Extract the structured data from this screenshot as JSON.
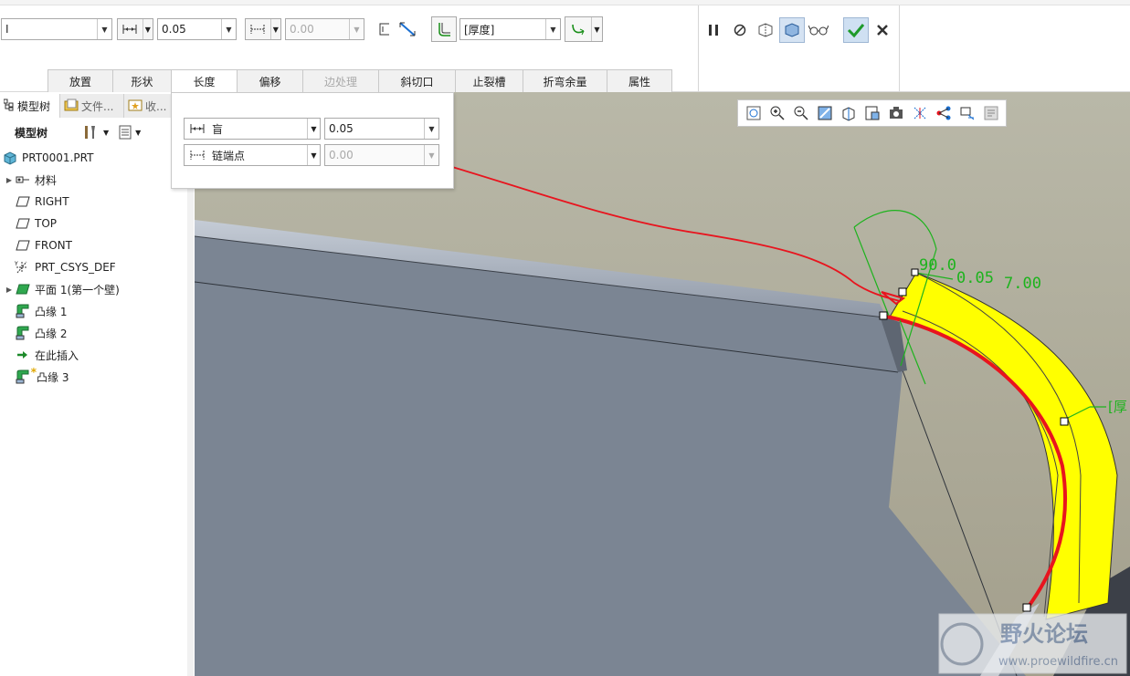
{
  "dashboard": {
    "type_combo": {
      "value": "I"
    },
    "length_value": "0.05",
    "second_length_value": "0.00",
    "thickness_combo": {
      "value": "[厚度]"
    }
  },
  "tabs": [
    {
      "label": "放置"
    },
    {
      "label": "形状"
    },
    {
      "label": "长度"
    },
    {
      "label": "偏移"
    },
    {
      "label": "边处理"
    },
    {
      "label": "斜切口"
    },
    {
      "label": "止裂槽"
    },
    {
      "label": "折弯余量"
    },
    {
      "label": "属性"
    }
  ],
  "length_panel": {
    "row1": {
      "type": "盲",
      "value": "0.05"
    },
    "row2": {
      "type": "链端点",
      "value": "0.00"
    }
  },
  "left_panel": {
    "tabs": [
      "模型树",
      "文件...",
      "收..."
    ],
    "toolbar_label": "模型树",
    "tree": [
      {
        "label": "PRT0001.PRT",
        "icon": "part-icon",
        "expandable": false,
        "indent": 0
      },
      {
        "label": "材料",
        "icon": "material-icon",
        "expandable": true,
        "indent": 1
      },
      {
        "label": "RIGHT",
        "icon": "datum-plane-icon",
        "expandable": false,
        "indent": 1
      },
      {
        "label": "TOP",
        "icon": "datum-plane-icon",
        "expandable": false,
        "indent": 1
      },
      {
        "label": "FRONT",
        "icon": "datum-plane-icon",
        "expandable": false,
        "indent": 1
      },
      {
        "label": "PRT_CSYS_DEF",
        "icon": "csys-icon",
        "expandable": false,
        "indent": 1
      },
      {
        "label": "平面 1(第一个壁)",
        "icon": "planar-wall-icon",
        "expandable": true,
        "indent": 1
      },
      {
        "label": "凸缘 1",
        "icon": "flange-icon",
        "expandable": false,
        "indent": 1
      },
      {
        "label": "凸缘 2",
        "icon": "flange-icon",
        "expandable": false,
        "indent": 1
      },
      {
        "label": "在此插入",
        "icon": "insert-arrow-icon",
        "expandable": false,
        "indent": 1
      },
      {
        "label": "凸缘 3",
        "icon": "flange-new-icon",
        "expandable": false,
        "indent": 1
      }
    ]
  },
  "graphics": {
    "dim_angle": "90.0",
    "dim_length": "0.05",
    "dim_radius": "7.00",
    "thickness_tag": "[厚",
    "watermark_title": "野火论坛",
    "watermark_url": "www.proewildfire.cn"
  },
  "colors": {
    "viewport_bg": "#a9a593",
    "part_face": "#7b8593",
    "flange_yellow": "#ffff00",
    "annotation_red": "#e8141e",
    "dimension_green": "#1db31d"
  }
}
